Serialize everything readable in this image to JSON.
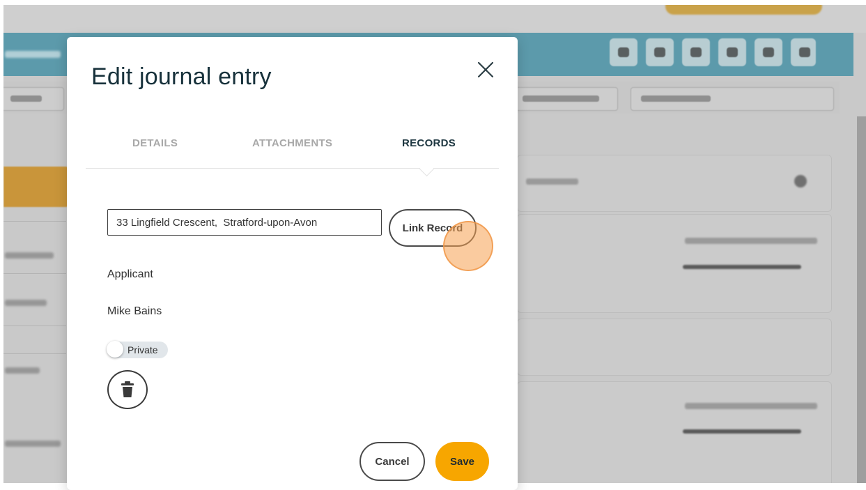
{
  "modal": {
    "title": "Edit journal entry",
    "tabs": [
      {
        "label": "DETAILS",
        "active": false
      },
      {
        "label": "ATTACHMENTS",
        "active": false
      },
      {
        "label": "RECORDS",
        "active": true
      }
    ],
    "records": {
      "search_value": "33 Lingfield Crescent,  Stratford-upon-Avon",
      "link_button_label": "Link Record",
      "record_type": "Applicant",
      "record_name": "Mike Bains",
      "private_label": "Private",
      "private_enabled": false
    },
    "footer": {
      "cancel_label": "Cancel",
      "save_label": "Save"
    }
  },
  "colors": {
    "accent": "#f7a600",
    "title": "#17313b",
    "header_bar": "#5c9aab",
    "overlay": "#c9c9c9"
  },
  "icons": {
    "close": "close-icon",
    "delete": "trash-icon"
  }
}
